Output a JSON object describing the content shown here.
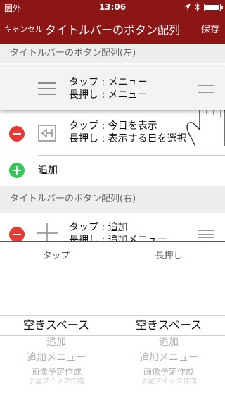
{
  "status": {
    "carrier": "圏外",
    "time": "13:06"
  },
  "nav": {
    "cancel": "キャンセル",
    "title": "タイトルバーのボタン配列",
    "save": "保存"
  },
  "left_section": {
    "header": "タイトルバーのボタン配列(左)",
    "rows": [
      {
        "line1": "タップ : メニュー",
        "line2": "長押し : メニュー",
        "icon": "menu-icon"
      },
      {
        "line1": "タップ : 今日を表示",
        "line2": "長押し : 表示する日を選択",
        "icon": "calendar-today-icon"
      }
    ],
    "add_label": "追加"
  },
  "right_section": {
    "header": "タイトルバーのボタン配列(右)",
    "rows": [
      {
        "line1": "タップ : 追加",
        "line2": "長押し : 追加メニュー",
        "icon": "plus-icon"
      }
    ]
  },
  "picker": {
    "tap_label": "タップ",
    "long_label": "長押し",
    "tap_items": [
      "空きスペース",
      "追加",
      "追加メニュー",
      "画像予定作成",
      "予定クイック作成"
    ],
    "long_items": [
      "空きスペース",
      "追加",
      "追加メニュー",
      "画像予定作成",
      "予定クイック作成"
    ]
  },
  "colors": {
    "bar": "#8c1515",
    "delete": "#e53935",
    "add": "#35c759"
  }
}
